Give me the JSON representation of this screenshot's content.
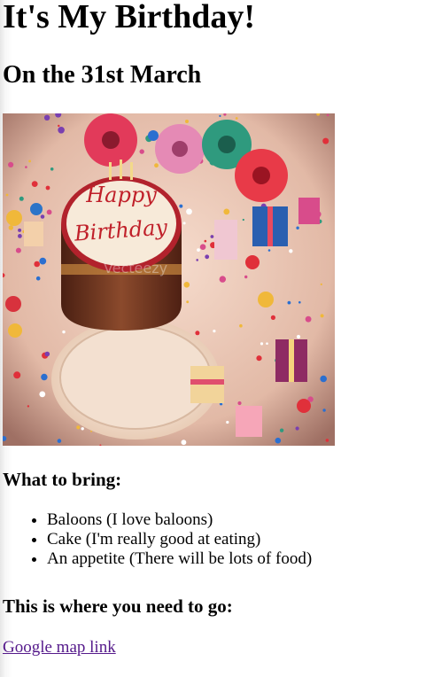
{
  "page": {
    "title": "It's My Birthday!",
    "date_heading": "On the 31st March",
    "image": {
      "icon": "birthday-cake-photo",
      "cake_text_line1": "Happy",
      "cake_text_line2": "Birthday",
      "watermark": "Vecteezy"
    },
    "bring_heading": "What to bring:",
    "bring_items": [
      "Baloons (I love baloons)",
      "Cake (I'm really good at eating)",
      "An appetite (There will be lots of food)"
    ],
    "location_heading": "This is where you need to go:",
    "map_link": "Google map link"
  },
  "colors": {
    "link": "#551a8b",
    "text": "#000000"
  }
}
